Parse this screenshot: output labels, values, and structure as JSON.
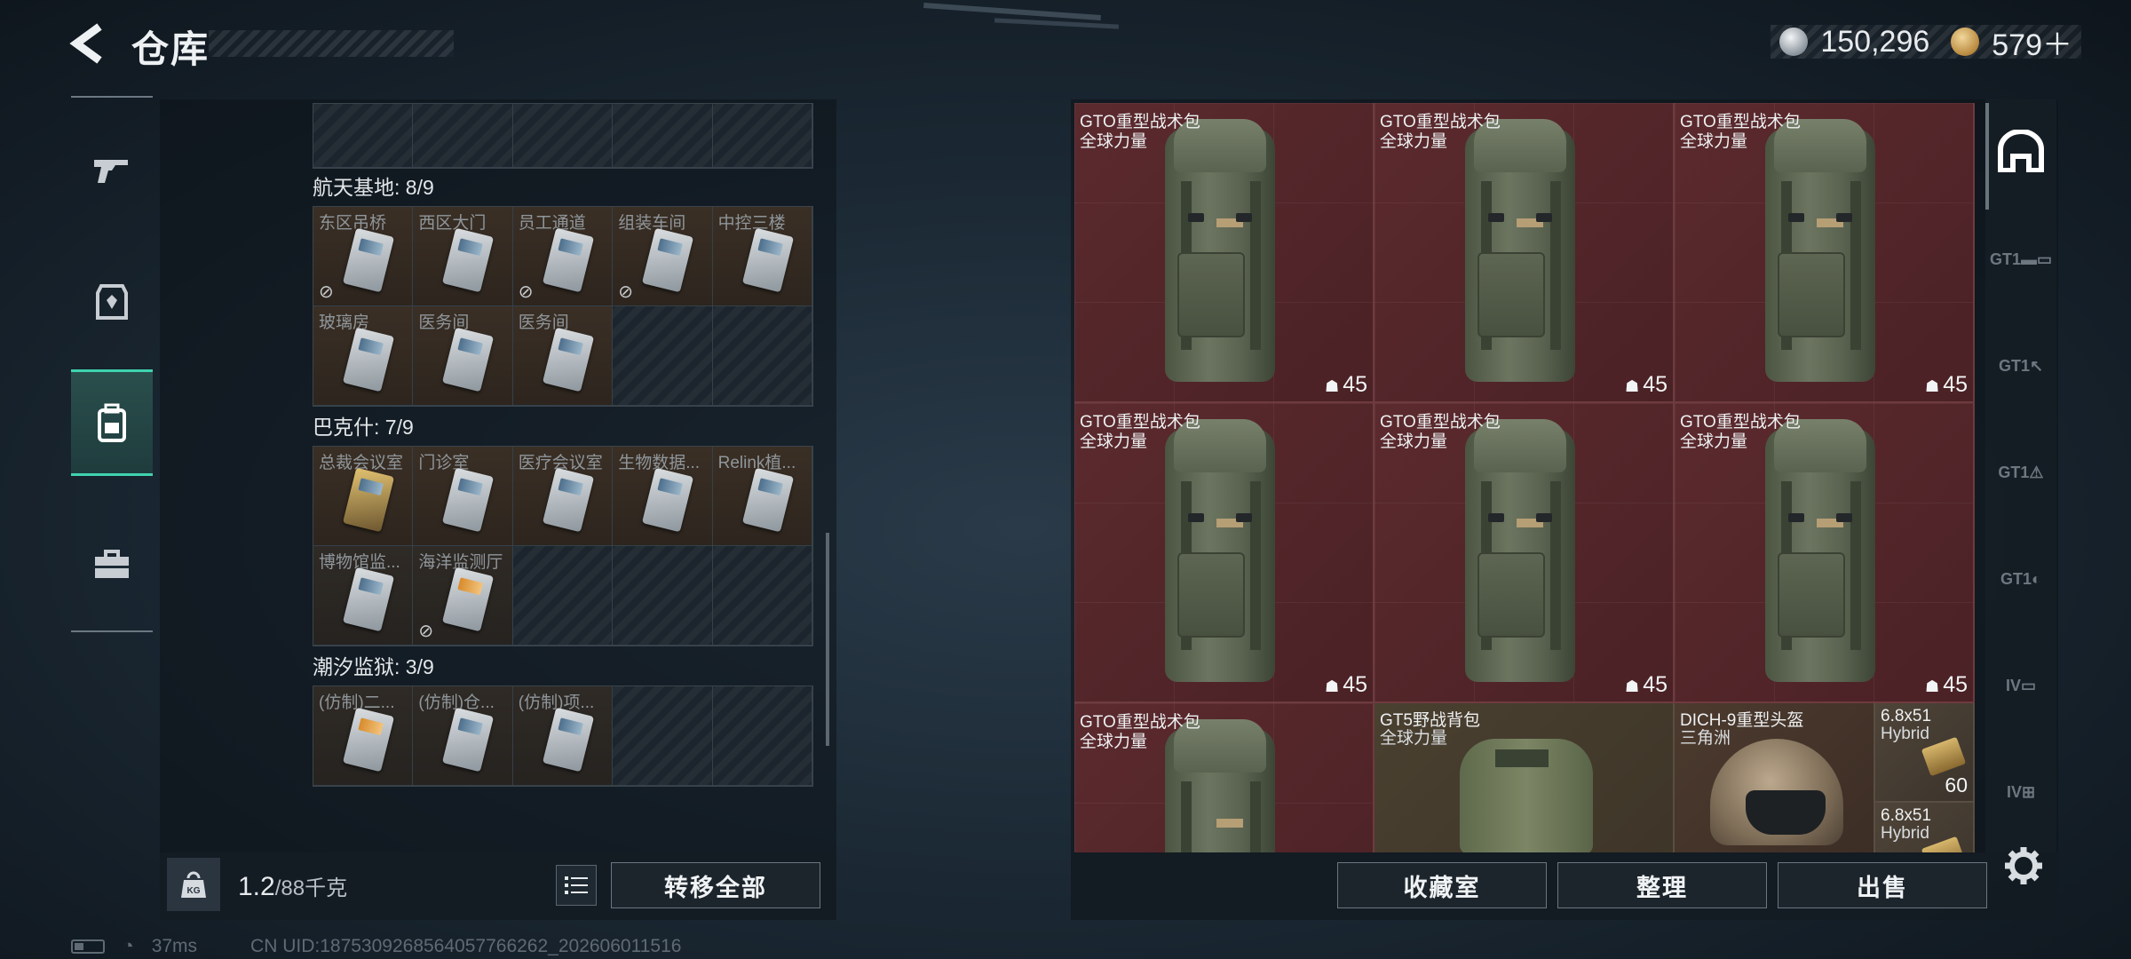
{
  "header": {
    "title": "仓库",
    "currency": [
      {
        "name": "silver-coin",
        "value": "150,296"
      },
      {
        "name": "gold-coin",
        "value": "579＋"
      }
    ]
  },
  "left_nav": [
    {
      "icon": "gun-icon",
      "active": false
    },
    {
      "icon": "armor-icon",
      "active": false
    },
    {
      "icon": "backpack-icon",
      "active": true
    },
    {
      "icon": "toolbox-icon",
      "active": false
    }
  ],
  "storage": {
    "sections": [
      {
        "label": "航天基地: 8/9",
        "cells": [
          {
            "label": "东区吊桥",
            "filled": true,
            "broken": true
          },
          {
            "label": "西区大门",
            "filled": true,
            "broken": false
          },
          {
            "label": "员工通道",
            "filled": true,
            "broken": true
          },
          {
            "label": "组装车间",
            "filled": true,
            "broken": true
          },
          {
            "label": "中控三楼",
            "filled": true,
            "broken": false
          },
          {
            "label": "玻璃房",
            "filled": true,
            "broken": false
          },
          {
            "label": "医务间",
            "filled": true,
            "broken": false
          },
          {
            "label": "医务间",
            "filled": true,
            "broken": false
          },
          {
            "label": "",
            "filled": false,
            "broken": false
          },
          {
            "label": "",
            "filled": false,
            "broken": false
          }
        ]
      },
      {
        "label": "巴克什: 7/9",
        "cells": [
          {
            "label": "总裁会议室",
            "filled": true,
            "broken": false,
            "gold": true
          },
          {
            "label": "门诊室",
            "filled": true,
            "broken": false
          },
          {
            "label": "医疗会议室",
            "filled": true,
            "broken": false
          },
          {
            "label": "生物数据...",
            "filled": true,
            "broken": false
          },
          {
            "label": "Relink植...",
            "filled": true,
            "broken": false
          },
          {
            "label": "博物馆监...",
            "filled": true,
            "broken": false
          },
          {
            "label": "海洋监测厅",
            "filled": true,
            "broken": true
          },
          {
            "label": "",
            "filled": false,
            "broken": false
          },
          {
            "label": "",
            "filled": false,
            "broken": false
          },
          {
            "label": "",
            "filled": false,
            "broken": false
          }
        ]
      },
      {
        "label": "潮汐监狱: 3/9",
        "cells": [
          {
            "label": "(仿制)二...",
            "filled": true,
            "broken": false,
            "orange": true
          },
          {
            "label": "(仿制)仓...",
            "filled": true,
            "broken": false
          },
          {
            "label": "(仿制)项...",
            "filled": true,
            "broken": false
          },
          {
            "label": "",
            "filled": false,
            "broken": false
          },
          {
            "label": "",
            "filled": false,
            "broken": false
          }
        ]
      }
    ],
    "weight_current": "1.2",
    "weight_max": "/88千克",
    "transfer_all": "转移全部"
  },
  "inventory": {
    "bags": [
      {
        "name": "GTO重型战术包",
        "sub": "全球力量",
        "durability": "45"
      },
      {
        "name": "GTO重型战术包",
        "sub": "全球力量",
        "durability": "45"
      },
      {
        "name": "GTO重型战术包",
        "sub": "全球力量",
        "durability": "45"
      },
      {
        "name": "GTO重型战术包",
        "sub": "全球力量",
        "durability": "45"
      },
      {
        "name": "GTO重型战术包",
        "sub": "全球力量",
        "durability": "45"
      },
      {
        "name": "GTO重型战术包",
        "sub": "全球力量",
        "durability": "45"
      },
      {
        "name": "GTO重型战术包",
        "sub": "全球力量",
        "durability": ""
      }
    ],
    "gt5": {
      "name": "GT5野战背包",
      "sub": "全球力量"
    },
    "helmet": {
      "name": "DICH-9重型头盔",
      "sub": "三角洲"
    },
    "ammo": [
      {
        "name": "6.8x51",
        "sub": "Hybrid",
        "count": "60"
      },
      {
        "name": "6.8x51",
        "sub": "Hybrid",
        "count": ""
      }
    ],
    "buttons": {
      "collection": "收藏室",
      "sort": "整理",
      "sell": "出售"
    }
  },
  "side_tabs": [
    {
      "icon": "backpack-tab-icon",
      "label": "",
      "active": true
    },
    {
      "icon": "gt1-rifle-tab-icon",
      "label": "GT1",
      "active": false
    },
    {
      "icon": "gt1-cursor-tab-icon",
      "label": "GT1",
      "active": false
    },
    {
      "icon": "gt1-warning-tab-icon",
      "label": "GT1",
      "active": false
    },
    {
      "icon": "gt1-tag-tab-icon",
      "label": "GT1",
      "active": false
    },
    {
      "icon": "iv-folder-tab-icon",
      "label": "IV",
      "active": false
    },
    {
      "icon": "iv-add-tab-icon",
      "label": "IV",
      "active": false
    }
  ],
  "status": {
    "ping": "37ms",
    "uid": "CN UID:1875309268564057766262_202606011516"
  }
}
